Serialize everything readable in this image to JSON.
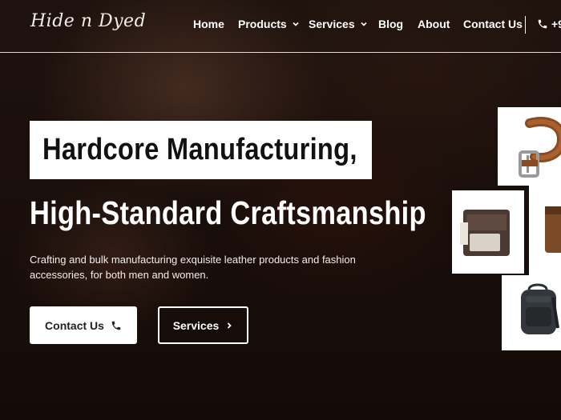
{
  "brand": {
    "logo_text": "Hide n Dyed"
  },
  "nav": {
    "items": [
      {
        "label": "Home"
      },
      {
        "label": "Products"
      },
      {
        "label": "Services"
      },
      {
        "label": "Blog"
      },
      {
        "label": "About"
      },
      {
        "label": "Contact Us"
      }
    ],
    "phone_label": "+9"
  },
  "hero": {
    "headline_line1": "Hardcore Manufacturing,",
    "headline_line2": "High-Standard Craftsmanship",
    "subtitle": "Crafting and bulk manufacturing exquisite leather products and fashion accessories, for both men and women.",
    "contact_button": "Contact Us",
    "services_button": "Services"
  },
  "products": [
    {
      "icon": "belt-icon"
    },
    {
      "icon": "wallet-icon"
    },
    {
      "icon": "brown-wallet-icon"
    },
    {
      "icon": "backpack-icon"
    }
  ],
  "colors": {
    "accent": "#ffffff",
    "dark_text": "#111111",
    "background": "#1a0f0c"
  }
}
